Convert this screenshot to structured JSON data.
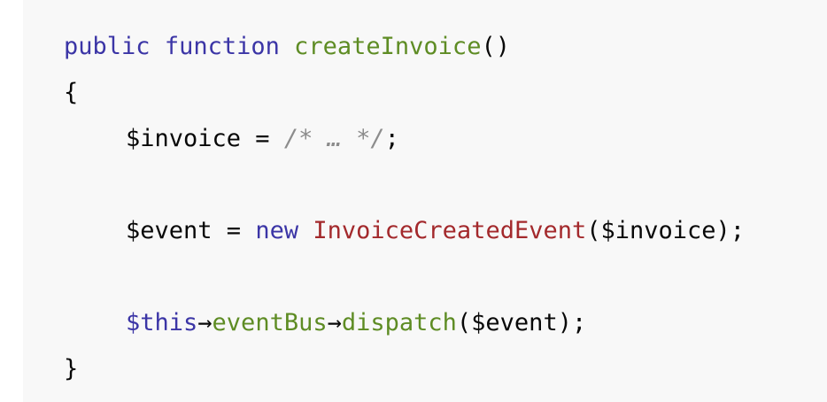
{
  "code": {
    "line1": {
      "kw_public": "public",
      "kw_function": "function",
      "fn_name": "createInvoice",
      "parens": "()"
    },
    "line2": {
      "brace": "{"
    },
    "line3": {
      "var": "$invoice",
      "op": " = ",
      "comment": "/* … */",
      "end": ";"
    },
    "line4": {
      "var": "$event",
      "op": " = ",
      "kw_new": "new",
      "cls": "InvoiceCreatedEvent",
      "args": "($invoice);"
    },
    "line5": {
      "this": "$this",
      "arrow1": "→",
      "prop": "eventBus",
      "arrow2": "→",
      "method": "dispatch",
      "args": "($event);"
    },
    "line6": {
      "brace": "}"
    }
  },
  "colors": {
    "keyword": "#3b35a6",
    "function": "#5e8c24",
    "class": "#a3292c",
    "comment": "#8c8c8c",
    "text": "#080808",
    "background": "#f8f8f8"
  }
}
